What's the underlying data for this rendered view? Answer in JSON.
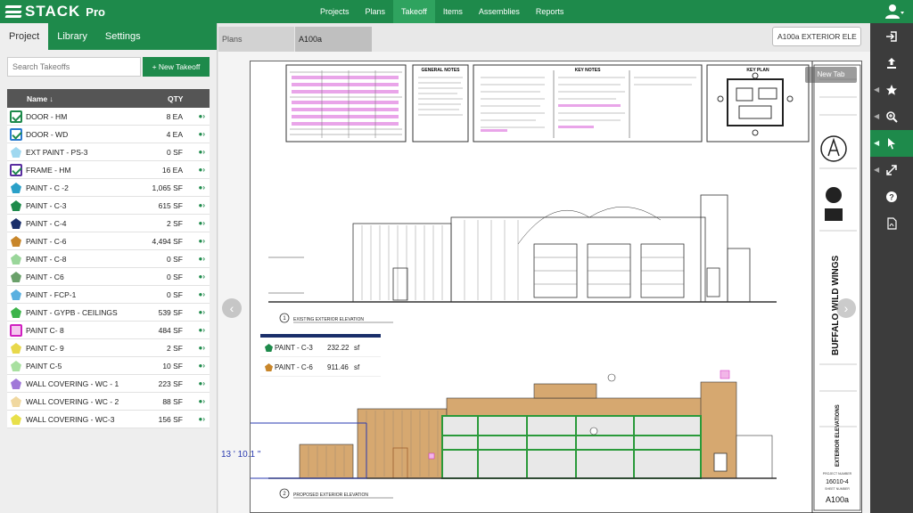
{
  "app": {
    "name": "STACK",
    "edition": "Pro"
  },
  "topnav": [
    "Projects",
    "Plans",
    "Takeoff",
    "Items",
    "Assemblies",
    "Reports"
  ],
  "topnav_active": 2,
  "left_tabs": [
    "Project",
    "Library",
    "Settings"
  ],
  "search": {
    "placeholder": "Search Takeoffs"
  },
  "new_takeoff_label": "+ New Takeoff",
  "table": {
    "headers": {
      "name": "Name ↓",
      "qty": "QTY"
    },
    "rows": [
      {
        "name": "DOOR - HM",
        "qty": "8 EA",
        "icon": "checkbox-checked",
        "color": "#1e8a4b"
      },
      {
        "name": "DOOR - WD",
        "qty": "4 EA",
        "icon": "checkbox-checked",
        "color": "#2a7bd0"
      },
      {
        "name": "EXT PAINT - PS-3",
        "qty": "0 SF",
        "icon": "pentagon",
        "color": "#9fd8f0"
      },
      {
        "name": "FRAME - HM",
        "qty": "16 EA",
        "icon": "checkbox-checked",
        "color": "#5a2ea0"
      },
      {
        "name": "PAINT - C -2",
        "qty": "1,065 SF",
        "icon": "pentagon",
        "color": "#2aa0c8"
      },
      {
        "name": "PAINT - C-3",
        "qty": "615 SF",
        "icon": "pentagon",
        "color": "#1e8a4b"
      },
      {
        "name": "PAINT - C-4",
        "qty": "2 SF",
        "icon": "pentagon",
        "color": "#1a2f6a"
      },
      {
        "name": "PAINT - C-6",
        "qty": "4,494 SF",
        "icon": "pentagon",
        "color": "#c8862a"
      },
      {
        "name": "PAINT - C-8",
        "qty": "0 SF",
        "icon": "pentagon",
        "color": "#9ad69a"
      },
      {
        "name": "PAINT - C6",
        "qty": "0 SF",
        "icon": "pentagon",
        "color": "#6aa06a"
      },
      {
        "name": "PAINT - FCP-1",
        "qty": "0 SF",
        "icon": "pentagon",
        "color": "#5ab0e0"
      },
      {
        "name": "PAINT - GYPB - CEILINGS",
        "qty": "539 SF",
        "icon": "pentagon",
        "color": "#3cb44a"
      },
      {
        "name": "PAINT C- 8",
        "qty": "484 SF",
        "icon": "square",
        "color": "#d020c0"
      },
      {
        "name": "PAINT C- 9",
        "qty": "2 SF",
        "icon": "pentagon",
        "color": "#e8d84a"
      },
      {
        "name": "PAINT C-5",
        "qty": "10 SF",
        "icon": "pentagon",
        "color": "#a8e0a0"
      },
      {
        "name": "WALL COVERING - WC - 1",
        "qty": "223 SF",
        "icon": "pentagon",
        "color": "#a078d8"
      },
      {
        "name": "WALL COVERING - WC - 2",
        "qty": "88 SF",
        "icon": "pentagon",
        "color": "#f0d8a0"
      },
      {
        "name": "WALL COVERING - WC-3",
        "qty": "156 SF",
        "icon": "pentagon",
        "color": "#e8e04a"
      }
    ]
  },
  "viewer": {
    "tabs": [
      "Plans",
      "A100a EXTERIOR"
    ],
    "close_glyph": "×",
    "sheet_select": "A100a EXTERIOR ELE ↕",
    "new_tab": "New Tab"
  },
  "sheet": {
    "notes": [
      "GENERAL NOTES",
      "KEY NOTES",
      "KEY PLAN"
    ],
    "elevation_1": "EXISTING EXTERIOR ELEVATION",
    "elevation_2": "PROPOSED EXTERIOR ELEVATION",
    "elevation_1_num": "1",
    "elevation_2_num": "2",
    "titleblock_project": "BUFFALO WILD WINGS",
    "titleblock_sheet_title": "EXTERIOR ELEVATIONS",
    "titleblock_project_number": "16010-4",
    "titleblock_sheet_number": "A100a",
    "titleblock_labels": [
      "PROJECT NUMBER",
      "SHEET NUMBER"
    ]
  },
  "summary": [
    {
      "name": "PAINT - C-3",
      "value": "232.22",
      "unit": "sf",
      "color": "#1e8a4b"
    },
    {
      "name": "PAINT - C-6",
      "value": "911.46",
      "unit": "sf",
      "color": "#c8862a"
    }
  ],
  "measurement": "13 ' 10.1 \"",
  "right_tools": [
    "exit-icon",
    "upload-icon",
    "star-icon",
    "zoom-icon",
    "cursor-icon",
    "expand-icon",
    "help-icon",
    "pdf-icon"
  ],
  "colors": {
    "brand": "#1e8a4b",
    "brand_light": "#2fa35f",
    "toolbar": "#3c3c3c",
    "highlight_green": "#2a9a3a",
    "highlight_orange": "#d6a870",
    "measure": "#2a3ab0"
  }
}
